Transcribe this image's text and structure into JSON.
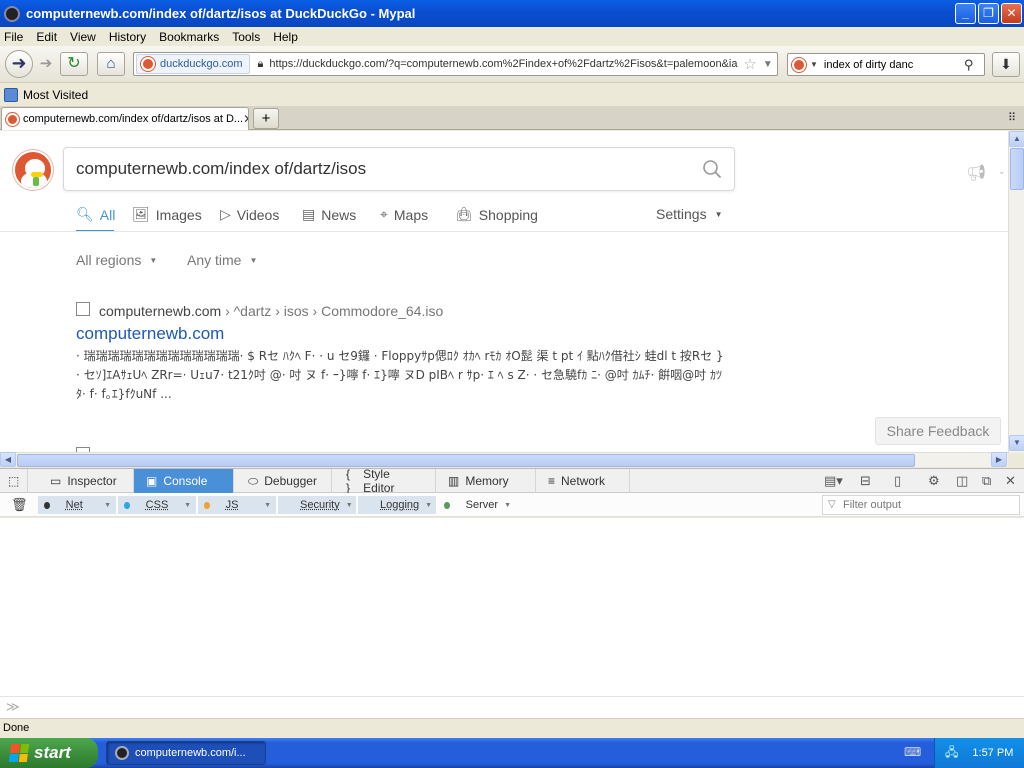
{
  "window": {
    "title": "computernewb.com/index of/dartz/isos at DuckDuckGo - Mypal"
  },
  "menu": [
    "File",
    "Edit",
    "View",
    "History",
    "Bookmarks",
    "Tools",
    "Help"
  ],
  "toolbar": {
    "identity": "duckduckgo.com",
    "url": "https://duckduckgo.com/?q=computernewb.com%2Findex+of%2Fdartz%2Fisos&t=palemoon&ia",
    "search_value": "index of dirty danc"
  },
  "bookmarks": {
    "most_visited": "Most Visited"
  },
  "tabs": {
    "active_title": "computernewb.com/index of/dartz/isos at D..."
  },
  "page": {
    "query": "computernewb.com/index of/dartz/isos",
    "nav": {
      "all": "All",
      "images": "Images",
      "videos": "Videos",
      "news": "News",
      "maps": "Maps",
      "shopping": "Shopping",
      "settings": "Settings"
    },
    "filters": {
      "regions": "All regions",
      "time": "Any time"
    },
    "result": {
      "domain": "computernewb.com",
      "crumbs": "› ^dartz › isos › Commodore_64.iso",
      "title": "computernewb.com",
      "snippet": "· 瑞瑞瑞瑞瑞瑞瑞瑞瑞瑞瑞瑞瑞· $ Rセ ﾊｸﾍ F· · u セ9鑼 · Floppyｻp偲ﾛｸ ｵｶﾍ rﾓｶ ｵO髭 渠 t pt ｲ 點ﾊｸ借社ｼ 蛙dl t 按Rセ }· セｿ]ｴAｻｪUﾍ ZRr=· Uｪu7· t21ｸ吋 @· 吋 ヌ f· ｰ}嚀 f· ｴ}嚀 ヌD pIBﾍ r ｻp· ｴ ﾍ s Z· · セ急驍fｶ ﾆ· @吋 ｶﾑﾁ· 餠咽@吋 ｶﾂﾀ· f· f｡ｴ}fｸuNf ..."
    },
    "share_feedback": "Share Feedback"
  },
  "devtools": {
    "tabs": {
      "inspector": "Inspector",
      "console": "Console",
      "debugger": "Debugger",
      "style_editor": "Style Editor",
      "memory": "Memory",
      "network": "Network"
    },
    "filters": {
      "net": "Net",
      "css": "CSS",
      "js": "JS",
      "security": "Security",
      "logging": "Logging",
      "server": "Server"
    },
    "filter_colors": {
      "net": "#333333",
      "css": "#2aa7e0",
      "js": "#f0a030",
      "security": "#e03a3a",
      "logging": "#888888",
      "server": "#5a9a5a"
    },
    "filter_placeholder": "Filter output",
    "input_prompt": "≫"
  },
  "status": {
    "text": "Done"
  },
  "taskbar": {
    "start": "start",
    "task_item": "computernewb.com/i...",
    "clock": "1:57 PM"
  }
}
